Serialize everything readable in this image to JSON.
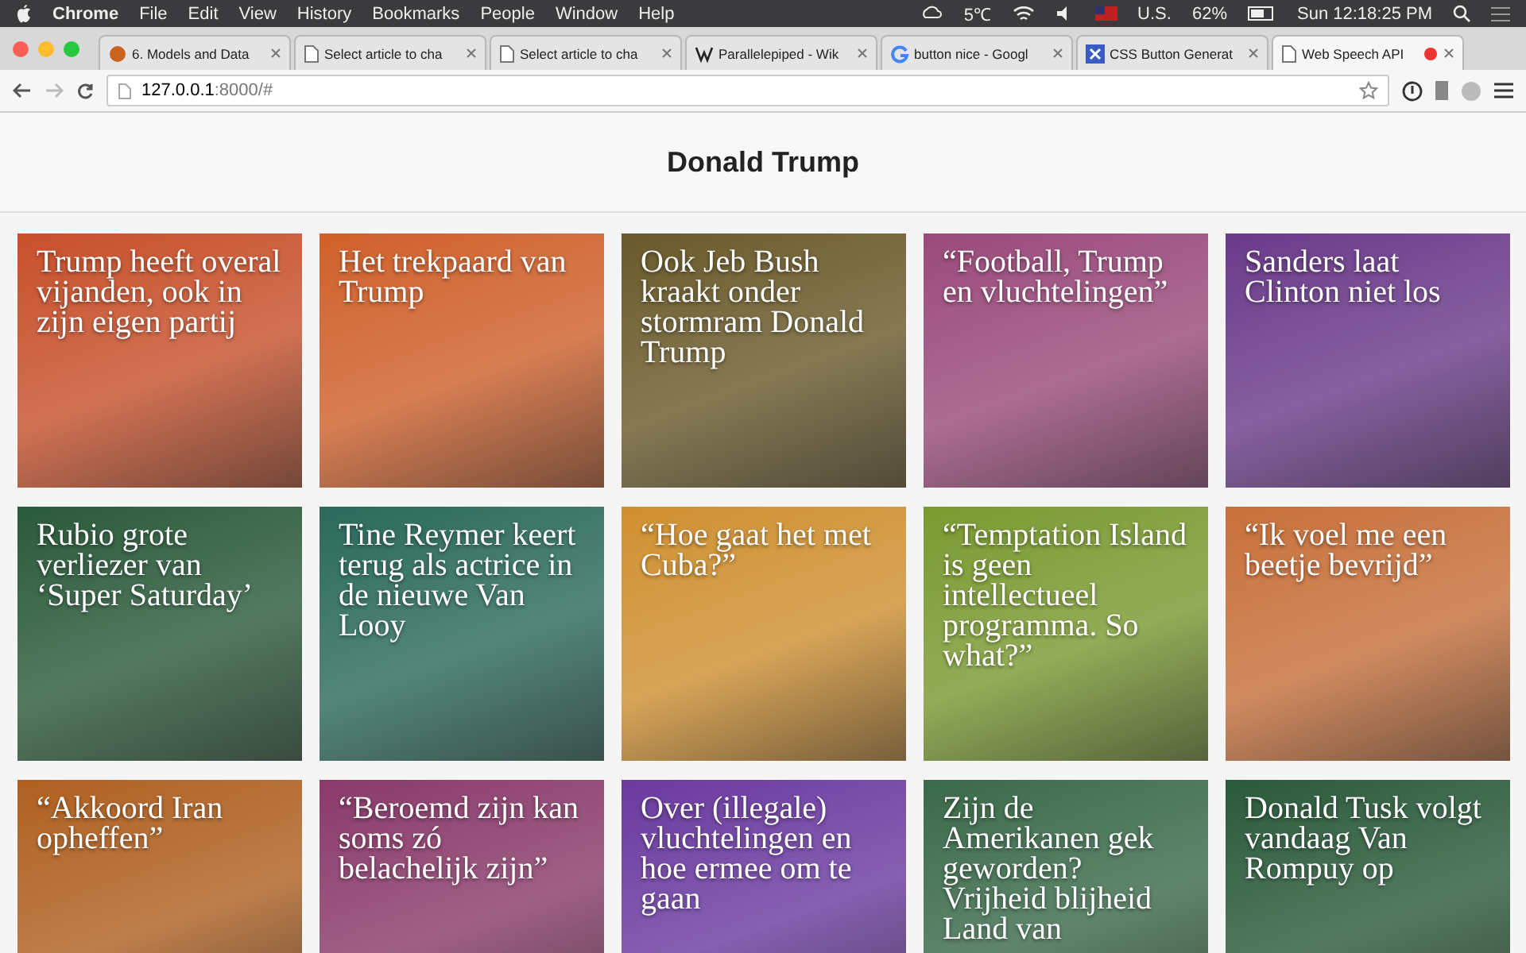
{
  "menu_bar": {
    "app": "Chrome",
    "items": [
      "File",
      "Edit",
      "View",
      "History",
      "Bookmarks",
      "People",
      "Window",
      "Help"
    ],
    "status": {
      "weather": "5℃",
      "input": "U.S.",
      "battery": "62%",
      "clock": "Sun 12:18:25 PM"
    }
  },
  "tabs": [
    {
      "label": "6. Models and Data",
      "selected": false,
      "recording": false
    },
    {
      "label": "Select article to cha",
      "selected": false,
      "recording": false
    },
    {
      "label": "Select article to cha",
      "selected": false,
      "recording": false
    },
    {
      "label": "Parallelepiped - Wik",
      "selected": false,
      "recording": false
    },
    {
      "label": "button nice - Googl",
      "selected": false,
      "recording": false
    },
    {
      "label": "CSS Button Generat",
      "selected": false,
      "recording": false
    },
    {
      "label": "Web Speech API",
      "selected": true,
      "recording": true
    }
  ],
  "address_bar": {
    "host": "127.0.0.1",
    "rest": ":8000/#"
  },
  "page": {
    "title": "Donald Trump",
    "articles": [
      {
        "title": "Trump heeft overal vijanden, ook in zijn eigen partij",
        "color": "#c8502a"
      },
      {
        "title": "Het trekpaard van Trump",
        "color": "#d0602a"
      },
      {
        "title": "Ook Jeb Bush kraakt onder stormram Donald Trump",
        "color": "#6a5a2a"
      },
      {
        "title": "“Football, Trump en vluchtelingen”",
        "color": "#9a4a7a"
      },
      {
        "title": "Sanders laat Clinton niet los",
        "color": "#6a3a8a"
      },
      {
        "title": "Rubio grote verliezer van ‘Super Saturday’",
        "color": "#2a5a3a"
      },
      {
        "title": "Tine Reymer keert terug als actrice in de nieuwe Van Looy",
        "color": "#2a6a5a"
      },
      {
        "title": "“Hoe gaat het met Cuba?”",
        "color": "#d09030"
      },
      {
        "title": "“Temptation Island is geen intellectueel programma. So what?”",
        "color": "#7a9a30"
      },
      {
        "title": "“Ik voel me een beetje bevrijd”",
        "color": "#c8703a"
      },
      {
        "title": "“Akkoord Iran opheffen”",
        "color": "#b06020"
      },
      {
        "title": "“Beroemd zijn kan soms zó belachelijk zijn”",
        "color": "#8a3a6a"
      },
      {
        "title": "Over (illegale) vluchtelingen en hoe ermee om te gaan",
        "color": "#6a3aa0"
      },
      {
        "title": "Zijn de Amerikanen gek geworden? Vrijheid blijheid Land van",
        "color": "#3a6a4a"
      },
      {
        "title": "Donald Tusk volgt vandaag Van Rompuy op",
        "color": "#2a5a3a"
      }
    ]
  }
}
